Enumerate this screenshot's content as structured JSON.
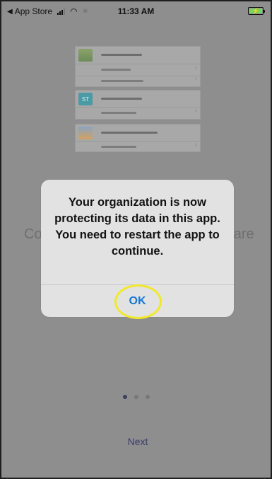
{
  "status_bar": {
    "back_label": "App Store",
    "time": "11:33 AM",
    "back_icon": "chevron-left-icon",
    "signal_icon": "signal-icon",
    "wifi_icon": "wifi-icon",
    "loading_icon": "activity-icon",
    "battery_icon": "battery-charging-icon"
  },
  "background": {
    "heading_fragments": {
      "left": "Co",
      "right": "are"
    },
    "illustration": {
      "cards": [
        {
          "thumb_icon": "image-icon",
          "thumb_text": "",
          "rows": 3
        },
        {
          "thumb_icon": "st-icon",
          "thumb_text": "ST",
          "rows": 2
        },
        {
          "thumb_icon": "weather-icon",
          "thumb_text": "",
          "rows": 2
        }
      ]
    },
    "pager": {
      "active_index": 0,
      "count": 3
    },
    "next_label": "Next"
  },
  "alert": {
    "message": "Your organization is now protecting its data in this app. You need to restart the app to continue.",
    "ok_label": "OK"
  },
  "colors": {
    "overlay": "#8e8e8e",
    "alert_bg": "#e2e2e2",
    "ok_blue": "#1577d9",
    "highlight_yellow": "#f2e82b",
    "next_text": "#3b3b68",
    "battery_green": "#7ad35e"
  }
}
